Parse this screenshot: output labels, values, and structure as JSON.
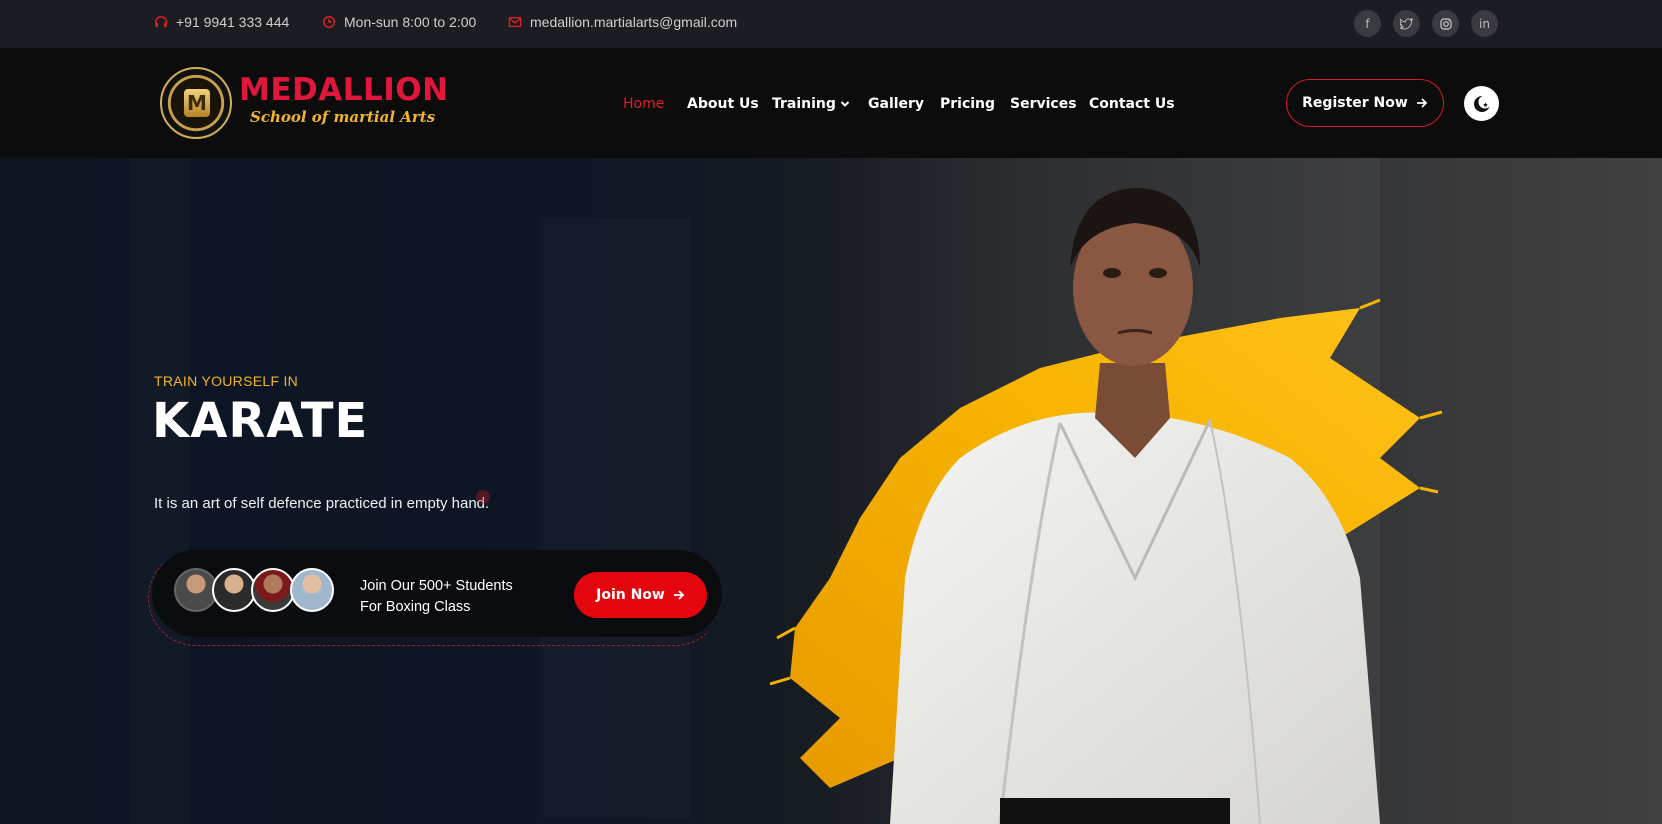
{
  "topbar": {
    "phone": "+91 9941 333 444",
    "hours": "Mon-sun 8:00 to 2:00",
    "email": "medallion.martialarts@gmail.com",
    "social_icons": [
      "facebook-icon",
      "twitter-icon",
      "instagram-icon",
      "linkedin-icon"
    ],
    "social_glyphs": [
      "f",
      "🐦",
      "◎",
      "in"
    ]
  },
  "header": {
    "logo_title": "MEDALLION",
    "logo_subtitle": "School of martial Arts",
    "nav": [
      {
        "label": "Home",
        "active": true
      },
      {
        "label": "About Us"
      },
      {
        "label": "Training",
        "has_dropdown": true
      },
      {
        "label": "Gallery"
      },
      {
        "label": "Pricing"
      },
      {
        "label": "Services"
      },
      {
        "label": "Contact Us"
      }
    ],
    "register_label": "Register Now"
  },
  "hero": {
    "kicker": "TRAIN YOURSELF IN",
    "title": "KARATE",
    "description": "It is an art of self defence practiced in empty hand.",
    "join_line1": "Join Our 500+ Students",
    "join_line2": "For Boxing Class",
    "join_button": "Join Now"
  },
  "colors": {
    "accent_red": "#e3060e",
    "accent_gold": "#f0b52a",
    "brush_orange": "#f4a900"
  }
}
